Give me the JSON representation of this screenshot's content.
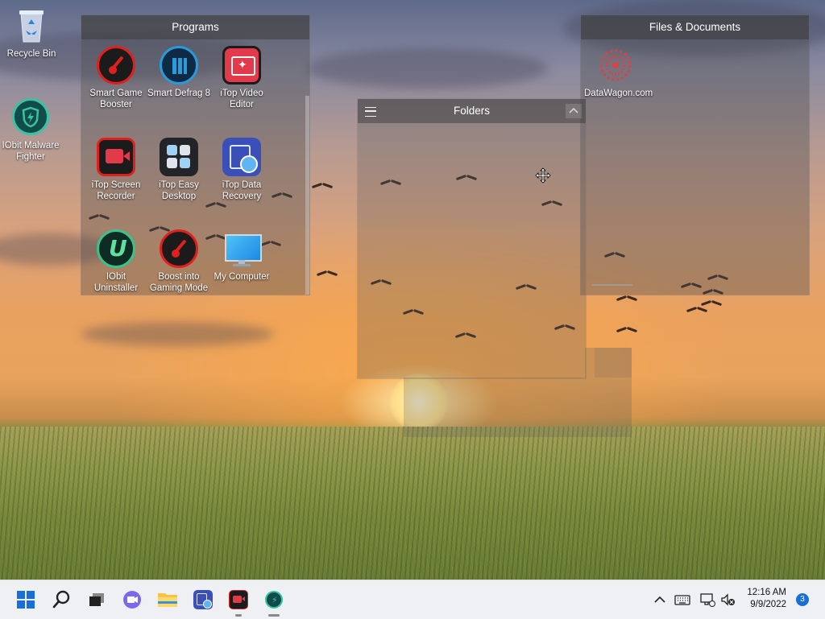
{
  "desktop": {
    "icons": [
      {
        "label": "Recycle Bin",
        "icon": "recycle-bin-icon"
      },
      {
        "label": "IObit Malware Fighter",
        "icon": "malware-fighter-icon"
      }
    ]
  },
  "fences": {
    "programs": {
      "title": "Programs",
      "items": [
        {
          "label": "Smart Game Booster",
          "icon": "game-booster-icon"
        },
        {
          "label": "Smart Defrag 8",
          "icon": "smart-defrag-icon"
        },
        {
          "label": "iTop Video Editor",
          "icon": "video-editor-icon"
        },
        {
          "label": "iTop Screen Recorder",
          "icon": "screen-recorder-icon"
        },
        {
          "label": "iTop Easy Desktop",
          "icon": "easy-desktop-icon"
        },
        {
          "label": "iTop Data Recovery",
          "icon": "data-recovery-icon"
        },
        {
          "label": "IObit Uninstaller",
          "icon": "uninstaller-icon"
        },
        {
          "label": "Boost into Gaming Mode",
          "icon": "gaming-mode-icon"
        },
        {
          "label": "My Computer",
          "icon": "computer-monitor-icon"
        }
      ]
    },
    "files": {
      "title": "Files & Documents",
      "items": [
        {
          "label": "DataWagon.com",
          "icon": "datawagon-icon"
        }
      ]
    },
    "folders": {
      "title": "Folders"
    }
  },
  "taskbar": {
    "time": "12:16 AM",
    "date": "9/9/2022",
    "notification_count": "3"
  },
  "colors": {
    "accent": "#1a6fd6",
    "booster_red": "#e0201f",
    "defrag_blue": "#2b9ad8",
    "malware_teal": "#39c2a3"
  }
}
